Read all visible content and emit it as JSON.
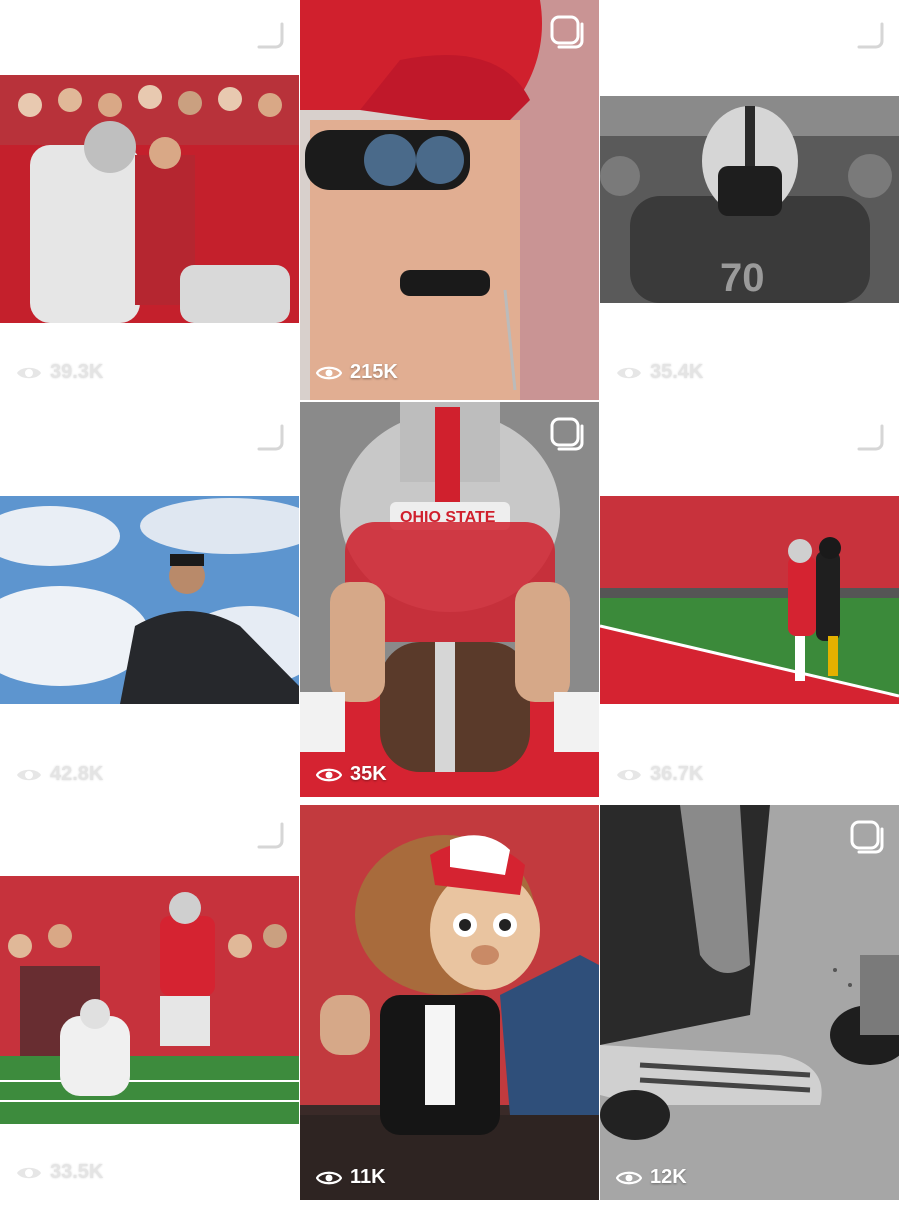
{
  "posts": [
    {
      "views": "39.3K",
      "label_style": "faint"
    },
    {
      "views": "215K",
      "label_style": "solid"
    },
    {
      "views": "35.4K",
      "label_style": "faint"
    },
    {
      "views": "42.8K",
      "label_style": "faint"
    },
    {
      "views": "35K",
      "label_style": "solid"
    },
    {
      "views": "36.7K",
      "label_style": "faint"
    },
    {
      "views": "33.5K",
      "label_style": "faint"
    },
    {
      "views": "11K",
      "label_style": "solid"
    },
    {
      "views": "12K",
      "label_style": "solid"
    }
  ],
  "icons": {
    "reel": "reel-icon",
    "views": "eye-icon"
  },
  "colors": {
    "scarlet": "#c8102e",
    "gray": "#a7a9ac",
    "white": "#ffffff"
  }
}
